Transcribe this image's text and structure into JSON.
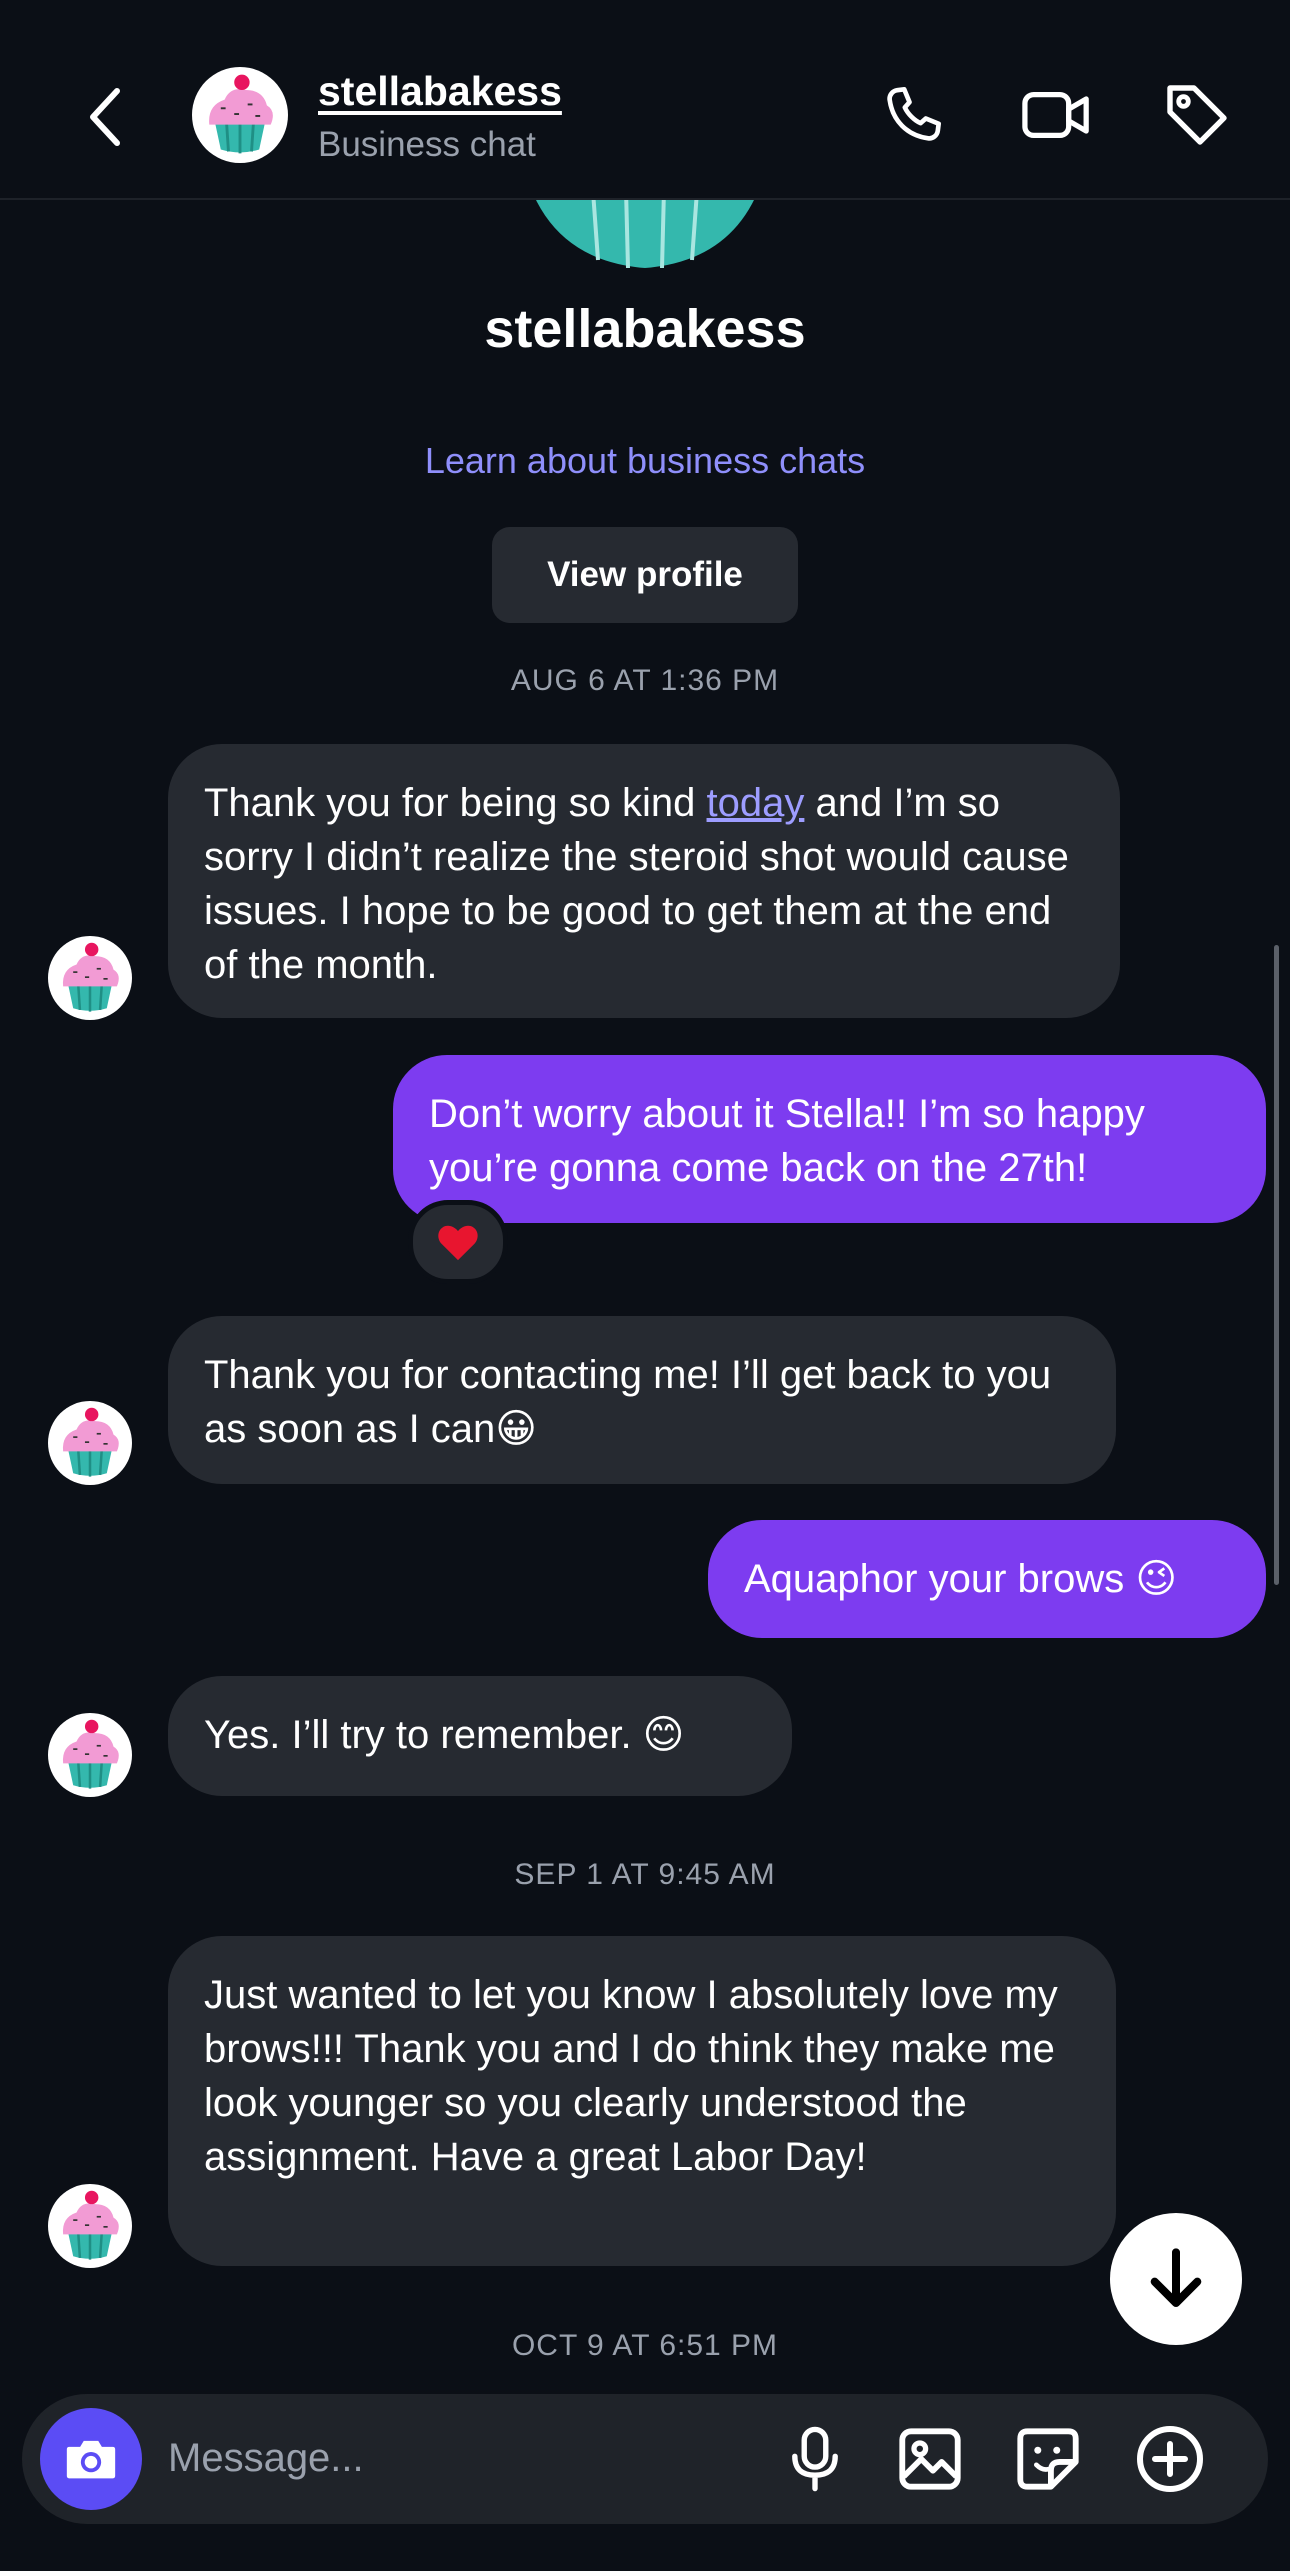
{
  "header": {
    "username": "stellabakess",
    "subtitle": "Business chat"
  },
  "profile": {
    "name": "stellabakess",
    "learn_link": "Learn about business chats",
    "view_profile_label": "View profile"
  },
  "messages": [
    {
      "type": "timestamp",
      "text": "AUG 6 AT 1:36 PM"
    },
    {
      "type": "incoming",
      "text_before": "Thank you for being so kind ",
      "link": "today",
      "text_after": " and I’m so sorry I didn’t realize the steroid shot would cause issues.  I hope to be good to get them at the end of the month."
    },
    {
      "type": "outgoing",
      "text": "Don’t worry about it Stella!! I’m so happy you’re gonna come back on the 27th!",
      "reaction": "❤️"
    },
    {
      "type": "incoming",
      "text": "Thank you for contacting me!  I’ll get back to you as soon as I can😀"
    },
    {
      "type": "outgoing",
      "text": "Aquaphor your brows 😉"
    },
    {
      "type": "incoming",
      "text": "Yes.  I’ll try to remember. 😊"
    },
    {
      "type": "timestamp",
      "text": "SEP 1 AT 9:45 AM"
    },
    {
      "type": "incoming",
      "text": "Just wanted to let you know I absolutely love my brows!!!  Thank you and I do think they make me look younger so you clearly understood the assignment.  Have a great Labor Day!"
    },
    {
      "type": "timestamp",
      "text": "OCT 9 AT 6:51 PM"
    }
  ],
  "composer": {
    "placeholder": "Message..."
  },
  "icons": {
    "back": "chevron-left-icon",
    "call": "phone-icon",
    "video": "video-camera-icon",
    "tag": "tag-icon",
    "camera": "camera-icon",
    "mic": "microphone-icon",
    "gallery": "image-icon",
    "sticker": "sticker-icon",
    "add": "plus-circle-icon",
    "scroll_down": "arrow-down-icon"
  },
  "colors": {
    "background": "#0b0f16",
    "incoming_bubble": "#262a31",
    "outgoing_bubble": "#7d3cf0",
    "accent_link": "#8f8ffb",
    "camera_button": "#5b4cf5"
  }
}
